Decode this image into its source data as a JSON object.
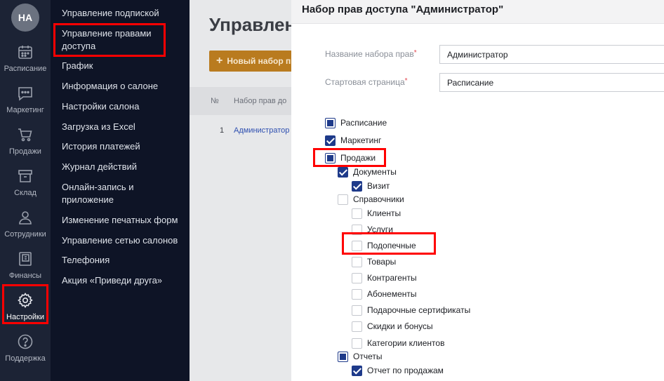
{
  "rail": {
    "avatar_initials": "НА",
    "items": [
      {
        "label": "Расписание",
        "icon": "calendar-icon"
      },
      {
        "label": "Маркетинг",
        "icon": "chat-icon"
      },
      {
        "label": "Продажи",
        "icon": "cart-icon"
      },
      {
        "label": "Склад",
        "icon": "box-icon"
      },
      {
        "label": "Сотрудники",
        "icon": "person-icon"
      },
      {
        "label": "Финансы",
        "icon": "ledger-icon"
      },
      {
        "label": "Настройки",
        "icon": "gear-icon"
      },
      {
        "label": "Поддержка",
        "icon": "help-icon"
      }
    ]
  },
  "subnav": {
    "items": [
      {
        "label": "Управление подпиской"
      },
      {
        "label": "Управление правами доступа"
      },
      {
        "label": "График"
      },
      {
        "label": "Информация о салоне"
      },
      {
        "label": "Настройки салона"
      },
      {
        "label": "Загрузка из Excel"
      },
      {
        "label": "История платежей"
      },
      {
        "label": "Журнал действий"
      },
      {
        "label": "Онлайн-запись и приложение"
      },
      {
        "label": "Изменение печатных форм"
      },
      {
        "label": "Управление сетью салонов"
      },
      {
        "label": "Телефония"
      },
      {
        "label": "Акция «Приведи друга»"
      }
    ]
  },
  "background": {
    "title": "Управлен",
    "new_button": "Новый набор п",
    "col_no": "№",
    "col_name": "Набор прав до",
    "row_no": "1",
    "row_name": "Администратор"
  },
  "panel": {
    "title": "Набор прав доступа \"Администратор\"",
    "fields": {
      "name_label": "Название набора прав",
      "name_value": "Администратор",
      "start_label": "Стартовая страница",
      "start_value": "Расписание",
      "required_mark": "*"
    },
    "tree": [
      {
        "label": "Расписание",
        "state": "partial"
      },
      {
        "label": "Маркетинг",
        "state": "checked"
      },
      {
        "label": "Продажи",
        "state": "partial"
      },
      {
        "label": "Документы",
        "state": "checked"
      },
      {
        "label": "Визит",
        "state": "checked"
      },
      {
        "label": "Справочники",
        "state": "unchecked"
      },
      {
        "label": "Клиенты",
        "state": "unchecked"
      },
      {
        "label": "Услуги",
        "state": "unchecked"
      },
      {
        "label": "Подопечные",
        "state": "unchecked"
      },
      {
        "label": "Товары",
        "state": "unchecked"
      },
      {
        "label": "Контрагенты",
        "state": "unchecked"
      },
      {
        "label": "Абонементы",
        "state": "unchecked"
      },
      {
        "label": "Подарочные сертификаты",
        "state": "unchecked"
      },
      {
        "label": "Скидки и бонусы",
        "state": "unchecked"
      },
      {
        "label": "Категории клиентов",
        "state": "unchecked"
      },
      {
        "label": "Отчеты",
        "state": "partial"
      },
      {
        "label": "Отчет по продажам",
        "state": "checked"
      }
    ]
  },
  "colors": {
    "rail_bg": "#1c2335",
    "nav_bg": "#0e1426",
    "accent_button": "#b97b1f",
    "checkbox_fill": "#1e3a8a",
    "highlight": "#ff0000",
    "link": "#2e4fb0"
  }
}
